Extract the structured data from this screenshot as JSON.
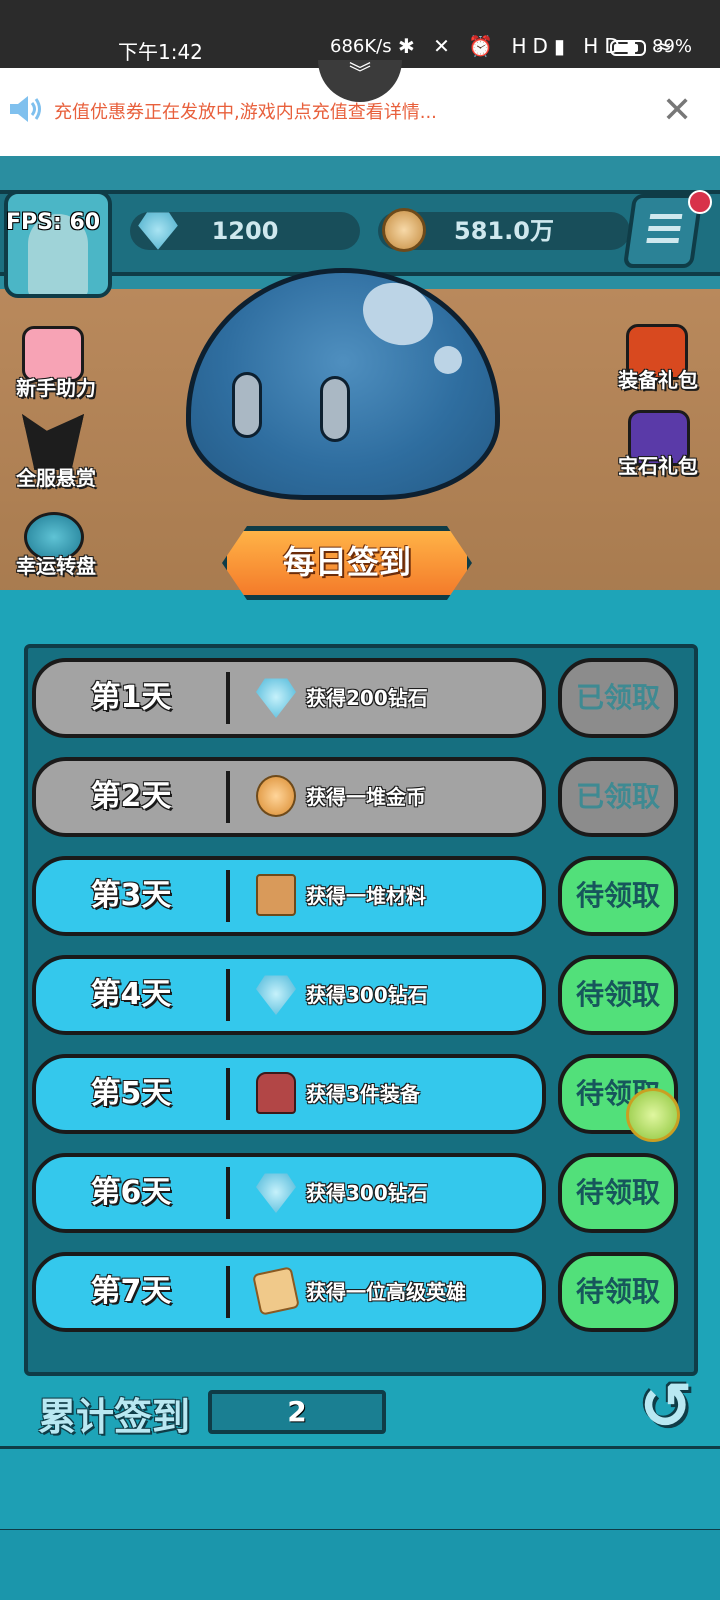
{
  "status_bar": {
    "time": "下午1:42",
    "network_speed": "686K/s",
    "status_icons": "✱ ✕ ⏰ HD▮ HD▮ ≈",
    "battery": "89"
  },
  "notice": {
    "text": "充值优惠券正在发放中,游戏内点充值查看详情...",
    "close_glyph": "✕",
    "collapse_glyph": "︾"
  },
  "hud": {
    "fps": "FPS: 60",
    "diamonds": "1200",
    "coins": "581.0万"
  },
  "side_left": {
    "newbie_help": "新手助力",
    "server_bounty": "全服悬赏",
    "lucky_wheel": "幸运转盘"
  },
  "side_right": {
    "equipment_pack": "装备礼包",
    "gem_pack": "宝石礼包"
  },
  "title": "每日签到",
  "days": [
    {
      "day": "第1天",
      "reward": "获得200钻石",
      "icon": "diamond-icon",
      "status": "已领取",
      "claimed": true
    },
    {
      "day": "第2天",
      "reward": "获得一堆金币",
      "icon": "coins-icon",
      "status": "已领取",
      "claimed": true
    },
    {
      "day": "第3天",
      "reward": "获得一堆材料",
      "icon": "box-icon",
      "status": "待领取",
      "claimed": false
    },
    {
      "day": "第4天",
      "reward": "获得300钻石",
      "icon": "diamond-icon",
      "status": "待领取",
      "claimed": false
    },
    {
      "day": "第5天",
      "reward": "获得3件装备",
      "icon": "chest-icon",
      "status": "待领取",
      "claimed": false
    },
    {
      "day": "第6天",
      "reward": "获得300钻石",
      "icon": "diamond-icon",
      "status": "待领取",
      "claimed": false
    },
    {
      "day": "第7天",
      "reward": "获得一位高级英雄",
      "icon": "scroll-icon",
      "status": "待领取",
      "claimed": false
    }
  ],
  "footer": {
    "total_label": "累计签到",
    "total_value": "2",
    "back_glyph": "↺"
  },
  "colors": {
    "claimed_row": "#a3a3a3",
    "pending_row": "#34c8ec",
    "pending_button": "#52e07a",
    "notice_text": "#e8603c"
  }
}
